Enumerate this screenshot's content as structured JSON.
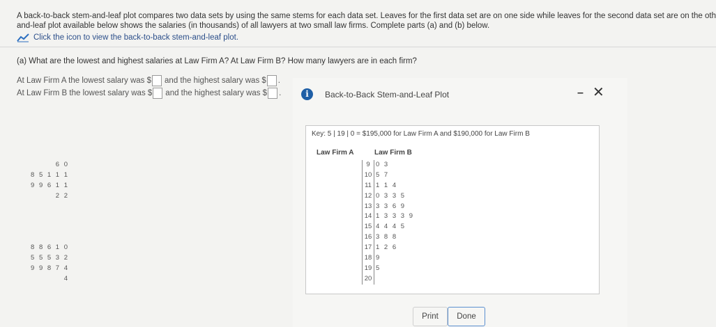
{
  "intro": {
    "line1": "A back-to-back stem-and-leaf plot compares two data sets by using the same stems for each data set. Leaves for the first data set are on one side while leaves for the second data set are on the other si",
    "line2": "and-leaf plot available below shows the salaries (in thousands) of all lawyers at two small law firms. Complete parts (a) and (b) below."
  },
  "link": {
    "label": "Click the icon to view the back-to-back stem-and-leaf plot.",
    "icon": "line-chart-icon"
  },
  "part_a": {
    "question": "(a) What are the lowest and highest salaries at Law Firm A? At Law Firm B? How many lawyers are in each firm?"
  },
  "rows": [
    {
      "prefix": "At Law Firm A the lowest salary was $",
      "middle": "and the highest salary was $",
      "suffix": "."
    },
    {
      "prefix": "At Law Firm B the lowest salary was $",
      "middle": "and the highest salary was $",
      "suffix": "."
    }
  ],
  "dialog": {
    "title": "Back-to-Back Stem-and-Leaf Plot",
    "info_icon": "i",
    "minimize": "–",
    "close": "✕",
    "key": "Key: 5 | 19 | 0 = $195,000 for Law Firm A and $190,000 for Law Firm B",
    "head_a": "Law Firm A",
    "head_b": "Law Firm B",
    "print": "Print",
    "done": "Done"
  },
  "plot_rows": [
    {
      "a": "6 0",
      "stem": "9",
      "b": "0 3"
    },
    {
      "a": "8 5 1 1 1",
      "stem": "10",
      "b": "5 7"
    },
    {
      "a": "9 9 6 1 1",
      "stem": "11",
      "b": "1 1 4"
    },
    {
      "a": "2 2",
      "stem": "12",
      "b": "0 3 3 5"
    },
    {
      "a": "",
      "stem": "13",
      "b": "3 3 6 9"
    },
    {
      "a": "",
      "stem": "14",
      "b": "1 3 3 3 9"
    },
    {
      "a": "",
      "stem": "15",
      "b": "4 4 4 5"
    },
    {
      "a": "",
      "stem": "16",
      "b": "3 8 8"
    },
    {
      "a": "8 8 6 1 0",
      "stem": "17",
      "b": "1 2 6"
    },
    {
      "a": "5 5 5 3 2",
      "stem": "18",
      "b": "9"
    },
    {
      "a": "9 9 8 7 4",
      "stem": "19",
      "b": "5"
    },
    {
      "a": "4",
      "stem": "20",
      "b": ""
    }
  ]
}
